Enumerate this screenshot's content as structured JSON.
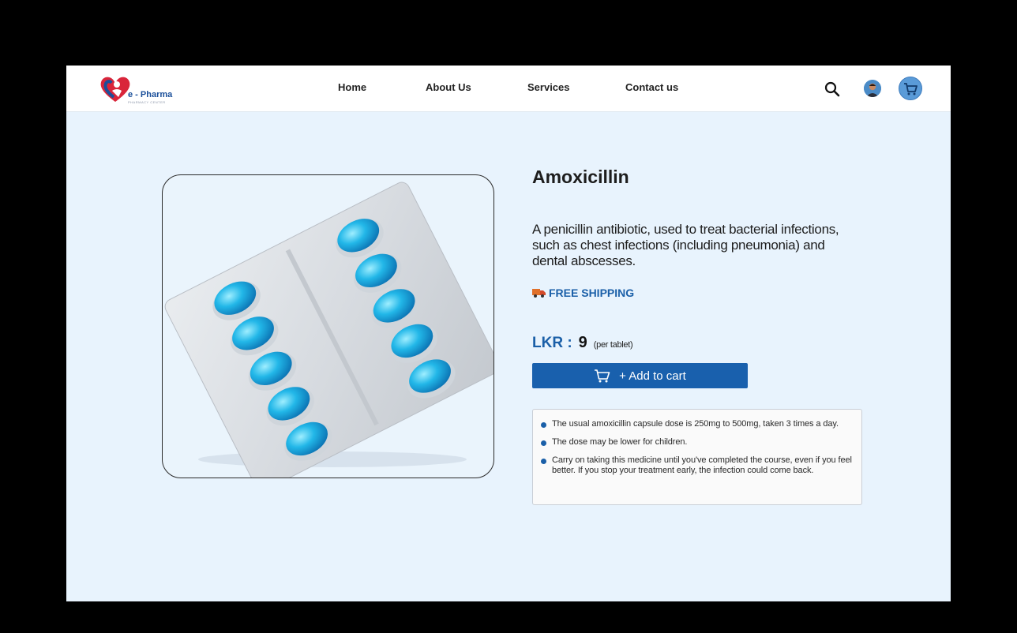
{
  "brand": {
    "name": "e - Pharma",
    "tagline": "PHARMACY CENTER",
    "color_primary": "#1a5fa8",
    "color_heart": "#d9253a"
  },
  "nav": {
    "items": [
      {
        "label": "Home"
      },
      {
        "label": "About Us"
      },
      {
        "label": "Services"
      },
      {
        "label": "Contact us"
      }
    ],
    "icons": [
      "search-icon",
      "user-avatar",
      "cart-icon"
    ]
  },
  "product": {
    "name": "Amoxicillin",
    "description": "A penicillin antibiotic, used to treat bacterial infections, such as chest infections (including pneumonia) and dental abscesses.",
    "shipping_label": "FREE SHIPPING",
    "shipping_icon": "truck-icon",
    "price_label": "LKR :",
    "price_value": "9",
    "price_unit": "(per tablet)",
    "add_to_cart_label": "+ Add to cart",
    "notes": [
      "The usual amoxicillin capsule dose is 250mg to 500mg, taken 3 times a day.",
      "The dose may be lower for children.",
      "Carry on taking this medicine until you've completed the course, even if you feel better. If you stop your treatment early, the infection could come back."
    ]
  }
}
